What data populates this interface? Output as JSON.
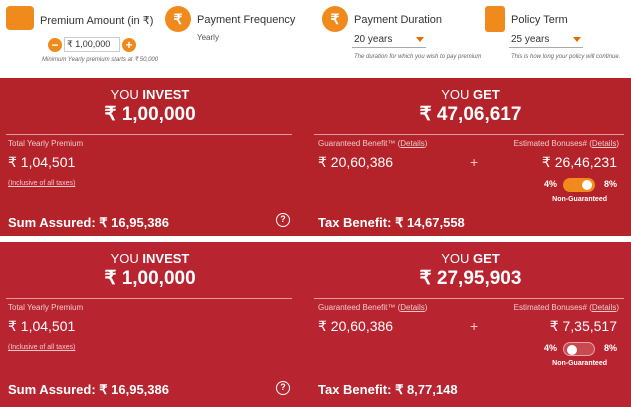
{
  "controls": {
    "premium": {
      "title": "Premium Amount (in ₹)",
      "value": "₹ 1,00,000",
      "minus": "−",
      "plus": "+",
      "note": "Minimum Yearly premium starts at ₹ 50,000"
    },
    "frequency": {
      "title": "Payment Frequency",
      "value": "Yearly"
    },
    "duration": {
      "title": "Payment Duration",
      "value": "20 years",
      "note": "The duration for which you wish to pay premium"
    },
    "term": {
      "title": "Policy Term",
      "value": "25 years",
      "note": "This is how long your policy will continue."
    }
  },
  "panels": [
    {
      "invest_label_pre": "YOU ",
      "invest_label_bold": "INVEST",
      "invest_amount": "₹ 1,00,000",
      "get_label_pre": "YOU ",
      "get_label_bold": "GET",
      "get_amount": "₹ 47,06,617",
      "total_yearly_label": "Total Yearly Premium",
      "total_yearly_value": "₹ 1,04,501",
      "taxes_note": "(Inclusive of all taxes)",
      "guaranteed_label": "Guaranteed Benefit™ (",
      "guaranteed_link": "Details",
      "guaranteed_close": ")",
      "guaranteed_value": "₹ 20,60,386",
      "plus": "+",
      "bonus_label": "Estimated Bonuses# (",
      "bonus_link": "Details",
      "bonus_close": ")",
      "bonus_value": "₹ 26,46,231",
      "rate_low": "4%",
      "rate_high": "8%",
      "non_guaranteed": "Non-Guaranteed",
      "sum_assured_label": "Sum Assured: ",
      "sum_assured_value": "₹ 16,95,386",
      "tax_benefit_label": "Tax Benefit: ",
      "tax_benefit_value": "₹ 14,67,558",
      "info": "?"
    },
    {
      "invest_label_pre": "YOU ",
      "invest_label_bold": "INVEST",
      "invest_amount": "₹ 1,00,000",
      "get_label_pre": "YOU ",
      "get_label_bold": "GET",
      "get_amount": "₹ 27,95,903",
      "total_yearly_label": "Total Yearly Premium",
      "total_yearly_value": "₹ 1,04,501",
      "taxes_note": "(Inclusive of all taxes)",
      "guaranteed_label": "Guaranteed Benefit™ (",
      "guaranteed_link": "Details",
      "guaranteed_close": ")",
      "guaranteed_value": "₹ 20,60,386",
      "plus": "+",
      "bonus_label": "Estimated Bonuses# (",
      "bonus_link": "Details",
      "bonus_close": ")",
      "bonus_value": "₹ 7,35,517",
      "rate_low": "4%",
      "rate_high": "8%",
      "non_guaranteed": "Non-Guaranteed",
      "sum_assured_label": "Sum Assured: ",
      "sum_assured_value": "₹ 16,95,386",
      "tax_benefit_label": "Tax Benefit: ",
      "tax_benefit_value": "₹ 8,77,148",
      "info": "?"
    }
  ],
  "icons": {
    "premium": "hand-money-icon",
    "frequency": "rupee-cycle-icon",
    "duration": "rupee-hourglass-icon",
    "term": "lock-icon"
  },
  "colors": {
    "panel_red": "#b4222a",
    "accent_orange": "#f08a1c"
  }
}
